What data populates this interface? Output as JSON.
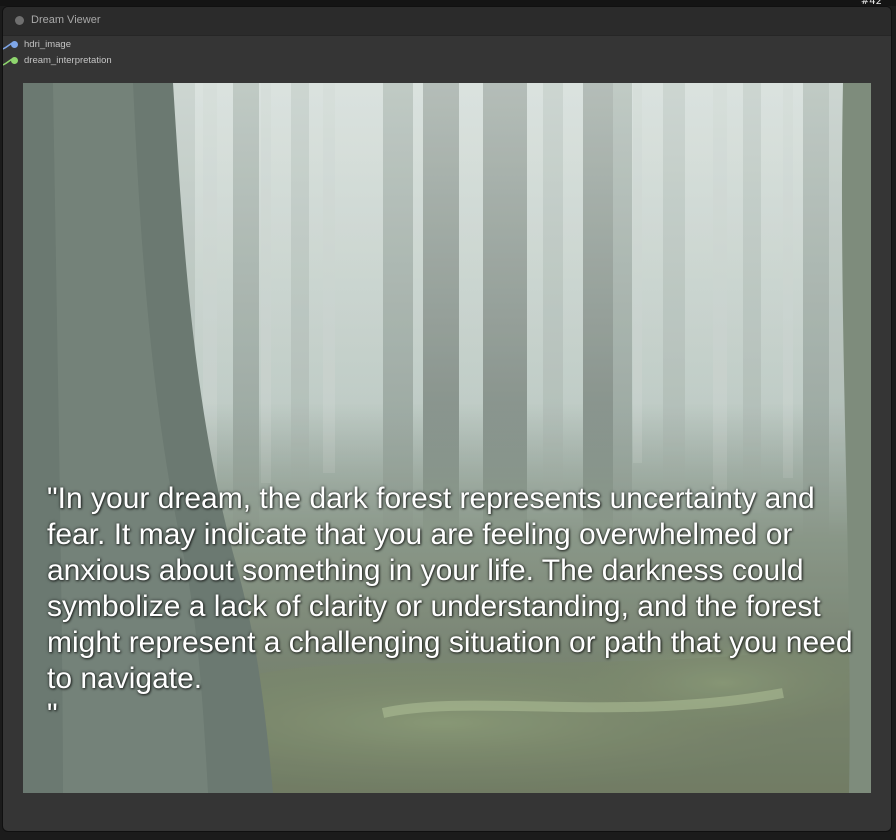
{
  "node": {
    "id": "#42",
    "title": "Dream Viewer",
    "inputs": [
      {
        "label": "hdri_image",
        "color": "#7ea6e8"
      },
      {
        "label": "dream_interpretation",
        "color": "#8fd66e"
      }
    ]
  },
  "preview": {
    "scene": "misty-forest",
    "overlay_text": "\"In your dream, the dark forest represents uncertainty and fear. It may indicate that you are feeling overwhelmed or anxious about something in your life. The darkness could symbolize a lack of clarity or understanding, and the forest might represent a challenging situation or path that you need to navigate.\n\""
  },
  "colors": {
    "node_background": "#353535",
    "header_background": "#2b2b2b",
    "canvas_background": "#1b1b1b"
  }
}
